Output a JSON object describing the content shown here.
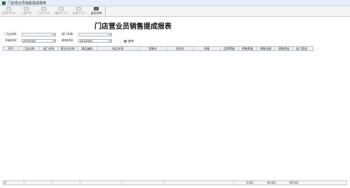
{
  "window": {
    "title": "门店营业员销售提成报表"
  },
  "toolbar": {
    "buttons": [
      {
        "label": "导出EXCEL"
      },
      {
        "label": "上报(F9)"
      },
      {
        "label": "下拉(F10)"
      },
      {
        "label": "重新(F11)"
      },
      {
        "label": "关闭(F12)"
      },
      {
        "label": "退出系统"
      }
    ]
  },
  "report": {
    "title": "门店营业员销售提成报表"
  },
  "filters": {
    "store_label": "门店名称：",
    "store_value": "",
    "dept_label": "部门名称：",
    "dept_value": "",
    "start_label": "开始时间：",
    "start_value": "2014/4/4",
    "end_label": "结束时间：",
    "end_value": "2014/4/4",
    "query_label": "查询"
  },
  "table": {
    "columns": [
      "序号",
      "门店名称",
      "部门名称",
      "营业员名称",
      "商品编码",
      "商品名称",
      "销售价",
      "批发价",
      "规格",
      "品牌等级",
      "销售数量",
      "销售金额",
      "销售提成",
      "部门提成"
    ],
    "rows": []
  },
  "status": {
    "cells": [
      "0",
      "",
      "",
      "",
      "",
      "",
      "0.00",
      "¥0.00",
      "¥0.00",
      ""
    ]
  }
}
